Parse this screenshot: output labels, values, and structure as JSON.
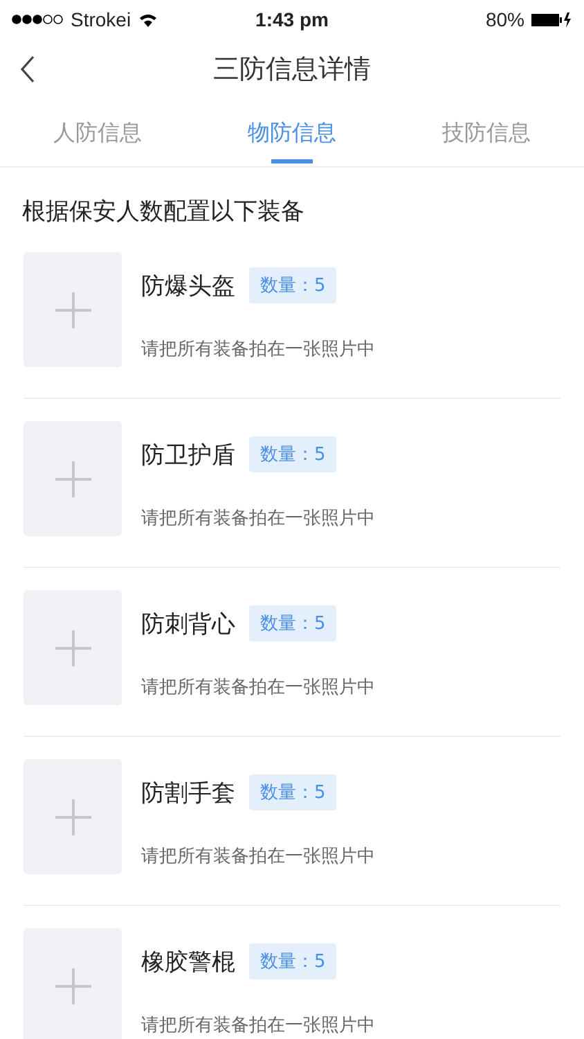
{
  "status_bar": {
    "carrier": "Strokei",
    "time": "1:43 pm",
    "battery": "80%"
  },
  "nav": {
    "title": "三防信息详情"
  },
  "tabs": [
    {
      "label": "人防信息",
      "selected": false
    },
    {
      "label": "物防信息",
      "selected": true
    },
    {
      "label": "技防信息",
      "selected": false
    }
  ],
  "heading": "根据保安人数配置以下装备",
  "items": [
    {
      "name": "防爆头盔",
      "quantity": "数量：5",
      "hint": "请把所有装备拍在一张照片中"
    },
    {
      "name": "防卫护盾",
      "quantity": "数量：5",
      "hint": "请把所有装备拍在一张照片中"
    },
    {
      "name": "防刺背心",
      "quantity": "数量：5",
      "hint": "请把所有装备拍在一张照片中"
    },
    {
      "name": "防割手套",
      "quantity": "数量：5",
      "hint": "请把所有装备拍在一张照片中"
    },
    {
      "name": "橡胶警棍",
      "quantity": "数量：5",
      "hint": "请把所有装备拍在一张照片中"
    }
  ]
}
